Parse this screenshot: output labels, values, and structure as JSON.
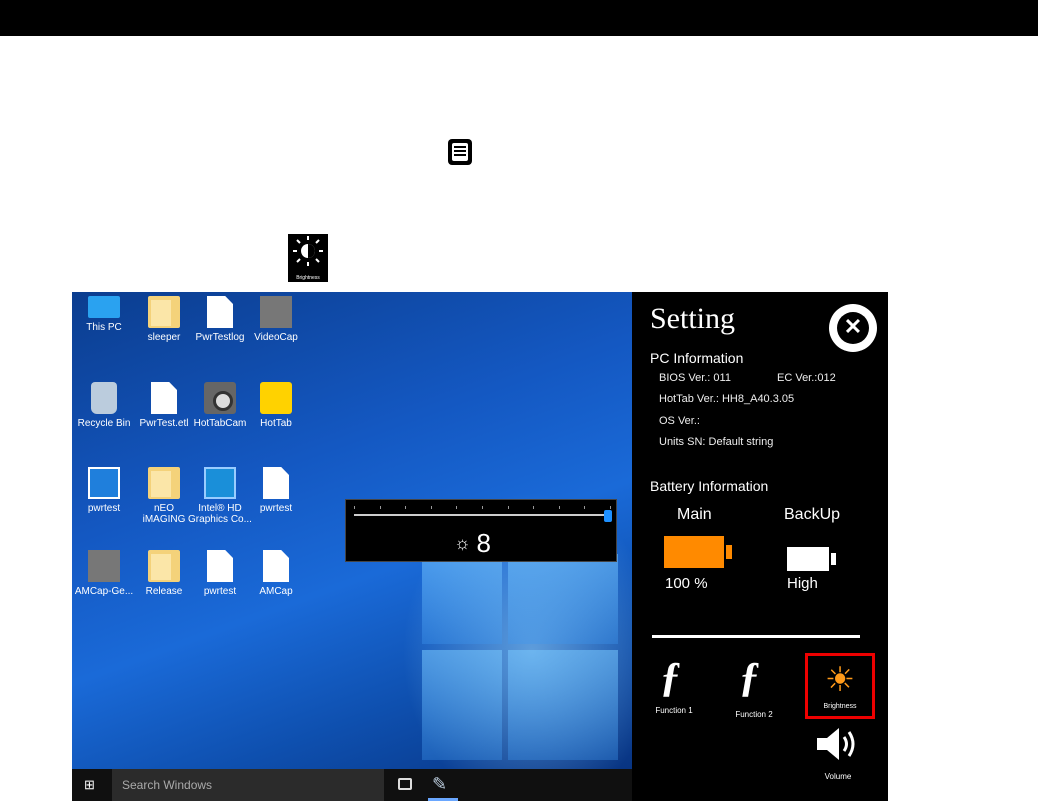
{
  "top_icons": {
    "doc_icon": "document-icon",
    "brightness_label": "Brightness"
  },
  "desktop": {
    "icons": [
      {
        "label": "This PC",
        "kind": "pc"
      },
      {
        "label": "sleeper",
        "kind": "folder"
      },
      {
        "label": "PwrTestlog",
        "kind": "file"
      },
      {
        "label": "VideoCap",
        "kind": "video"
      },
      {
        "label": "Recycle Bin",
        "kind": "bin"
      },
      {
        "label": "PwrTest.etl",
        "kind": "file"
      },
      {
        "label": "HotTabCam",
        "kind": "cam"
      },
      {
        "label": "HotTab",
        "kind": "hottab"
      },
      {
        "label": "pwrtest",
        "kind": "blueapp"
      },
      {
        "label": "nEO iMAGING",
        "kind": "folder"
      },
      {
        "label": "Intel® HD Graphics Co...",
        "kind": "intel"
      },
      {
        "label": "pwrtest",
        "kind": "file"
      },
      {
        "label": "AMCap-Ge...",
        "kind": "video"
      },
      {
        "label": "Release",
        "kind": "folder"
      },
      {
        "label": "pwrtest",
        "kind": "file"
      },
      {
        "label": "AMCap",
        "kind": "gear"
      }
    ]
  },
  "taskbar": {
    "search_placeholder": "Search Windows"
  },
  "osd": {
    "brightness_value": "8",
    "level_fraction": 1.0
  },
  "settings": {
    "title": "Setting",
    "pc_info_title": "PC Information",
    "bios": "BIOS Ver.: 011",
    "ec": "EC Ver.:012",
    "hottab": "HotTab Ver.: HH8_A40.3.05",
    "os": "OS Ver.:",
    "sn": "Units SN: Default string",
    "battery_title": "Battery Information",
    "main_label": "Main",
    "backup_label": "BackUp",
    "main_value": "100 %",
    "backup_value": "High",
    "function1": "Function 1",
    "function2": "Function 2",
    "brightness": "Brightness",
    "volume": "Volume",
    "accent_color": "#ff8a00",
    "highlight_color": "#e00000"
  }
}
